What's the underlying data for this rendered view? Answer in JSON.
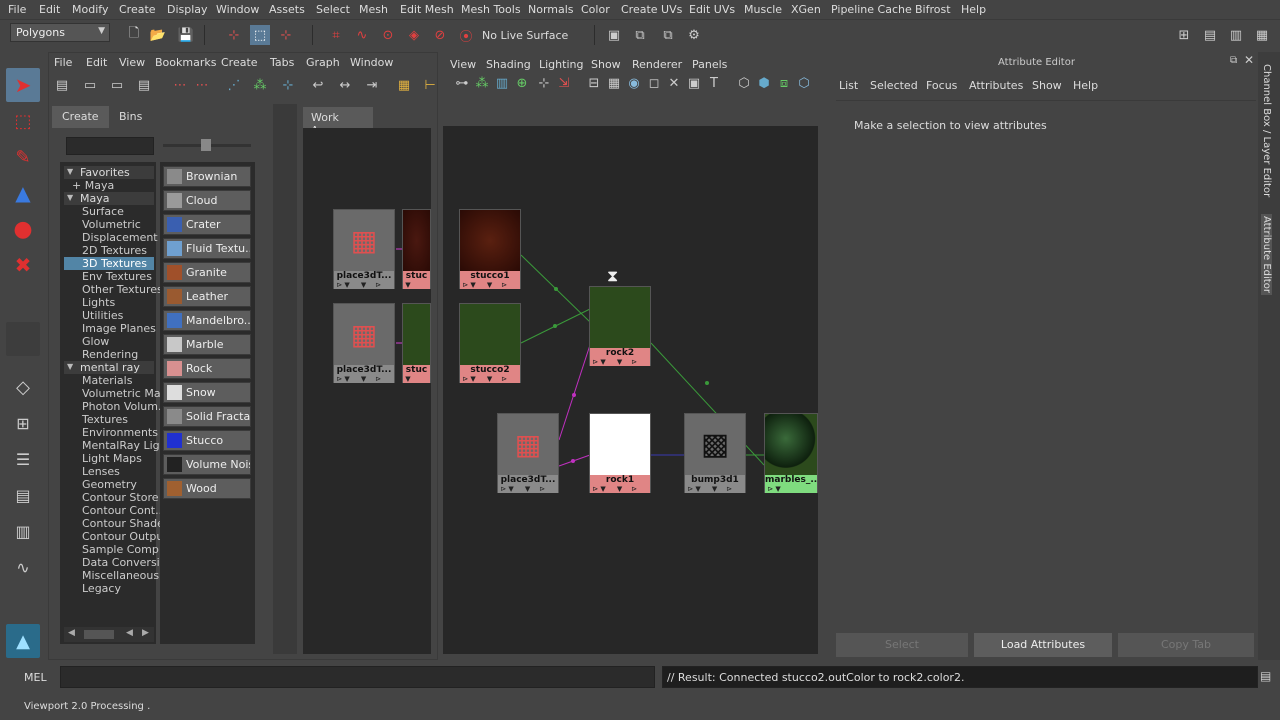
{
  "menubar": [
    "File",
    "Edit",
    "Modify",
    "Create",
    "Display",
    "Window",
    "Assets",
    "Select",
    "Mesh",
    "Edit Mesh",
    "Mesh Tools",
    "Normals",
    "Color",
    "Create UVs",
    "Edit UVs",
    "Muscle",
    "XGen",
    "Pipeline Cache",
    "Bifrost",
    "Help"
  ],
  "status": {
    "mode": "Polygons",
    "live_surface": "No Live Surface"
  },
  "hypershade": {
    "menu": [
      "File",
      "Edit",
      "View",
      "Bookmarks",
      "Create",
      "Tabs",
      "Graph",
      "Window"
    ],
    "tabs": [
      "Create",
      "Bins"
    ],
    "tree": [
      {
        "label": "Favorites",
        "type": "group"
      },
      {
        "label": "+ Maya",
        "type": "child"
      },
      {
        "label": "Maya",
        "type": "group"
      },
      {
        "label": "Surface",
        "type": "item"
      },
      {
        "label": "Volumetric",
        "type": "item"
      },
      {
        "label": "Displacement",
        "type": "item"
      },
      {
        "label": "2D Textures",
        "type": "item"
      },
      {
        "label": "3D Textures",
        "type": "selected"
      },
      {
        "label": "Env Textures",
        "type": "item"
      },
      {
        "label": "Other Textures",
        "type": "item"
      },
      {
        "label": "Lights",
        "type": "item"
      },
      {
        "label": "Utilities",
        "type": "item"
      },
      {
        "label": "Image Planes",
        "type": "item"
      },
      {
        "label": "Glow",
        "type": "item"
      },
      {
        "label": "Rendering",
        "type": "item"
      },
      {
        "label": "mental ray",
        "type": "group"
      },
      {
        "label": "Materials",
        "type": "item"
      },
      {
        "label": "Volumetric Ma...",
        "type": "item"
      },
      {
        "label": "Photon Volum...",
        "type": "item"
      },
      {
        "label": "Textures",
        "type": "item"
      },
      {
        "label": "Environments",
        "type": "item"
      },
      {
        "label": "MentalRay Lig...",
        "type": "item"
      },
      {
        "label": "Light Maps",
        "type": "item"
      },
      {
        "label": "Lenses",
        "type": "item"
      },
      {
        "label": "Geometry",
        "type": "item"
      },
      {
        "label": "Contour Store",
        "type": "item"
      },
      {
        "label": "Contour Cont...",
        "type": "item"
      },
      {
        "label": "Contour Shade",
        "type": "item"
      },
      {
        "label": "Contour Outpu",
        "type": "item"
      },
      {
        "label": "Sample Comp...",
        "type": "item"
      },
      {
        "label": "Data Conversi",
        "type": "item"
      },
      {
        "label": "Miscellaneous",
        "type": "item"
      },
      {
        "label": "Legacy",
        "type": "item"
      }
    ],
    "nodes": [
      {
        "label": "Brownian",
        "color": "#8a8a8a"
      },
      {
        "label": "Cloud",
        "color": "#9a9a9a"
      },
      {
        "label": "Crater",
        "color": "#3a5fb0"
      },
      {
        "label": "Fluid Textu...",
        "color": "#6fa0d0"
      },
      {
        "label": "Granite",
        "color": "#a0502a"
      },
      {
        "label": "Leather",
        "color": "#9a5a30"
      },
      {
        "label": "Mandelbro...",
        "color": "#4070c0"
      },
      {
        "label": "Marble",
        "color": "#c8c8c8"
      },
      {
        "label": "Rock",
        "color": "#d89090"
      },
      {
        "label": "Snow",
        "color": "#dddddd"
      },
      {
        "label": "Solid Fractal",
        "color": "#8a8a8a"
      },
      {
        "label": "Stucco",
        "color": "#2030d0"
      },
      {
        "label": "Volume Noise",
        "color": "#222222"
      },
      {
        "label": "Wood",
        "color": "#a06030"
      }
    ],
    "work_area_tab": "Work Area"
  },
  "view_menu": [
    "View",
    "Shading",
    "Lighting",
    "Show",
    "Renderer",
    "Panels"
  ],
  "graph_nodes": {
    "place1": "place3dT...",
    "stucco_a": "stuc",
    "stucco1": "stucco1",
    "place2": "place3dT...",
    "stucco_b": "stuc",
    "stucco2": "stucco2",
    "rock2": "rock2",
    "place3": "place3dT...",
    "rock1": "rock1",
    "bump": "bump3d1",
    "marbles": "marbles_..."
  },
  "attribute_editor": {
    "title": "Attribute Editor",
    "menu": [
      "List",
      "Selected",
      "Focus",
      "Attributes",
      "Show",
      "Help"
    ],
    "message": "Make a selection to view attributes",
    "buttons": [
      "Select",
      "Load Attributes",
      "Copy Tab"
    ]
  },
  "side_tabs": [
    "Channel Box / Layer Editor",
    "Attribute Editor"
  ],
  "mel": {
    "label": "MEL",
    "result": "// Result: Connected stucco2.outColor to rock2.color2."
  },
  "help_line": "Viewport 2.0 Processing ."
}
